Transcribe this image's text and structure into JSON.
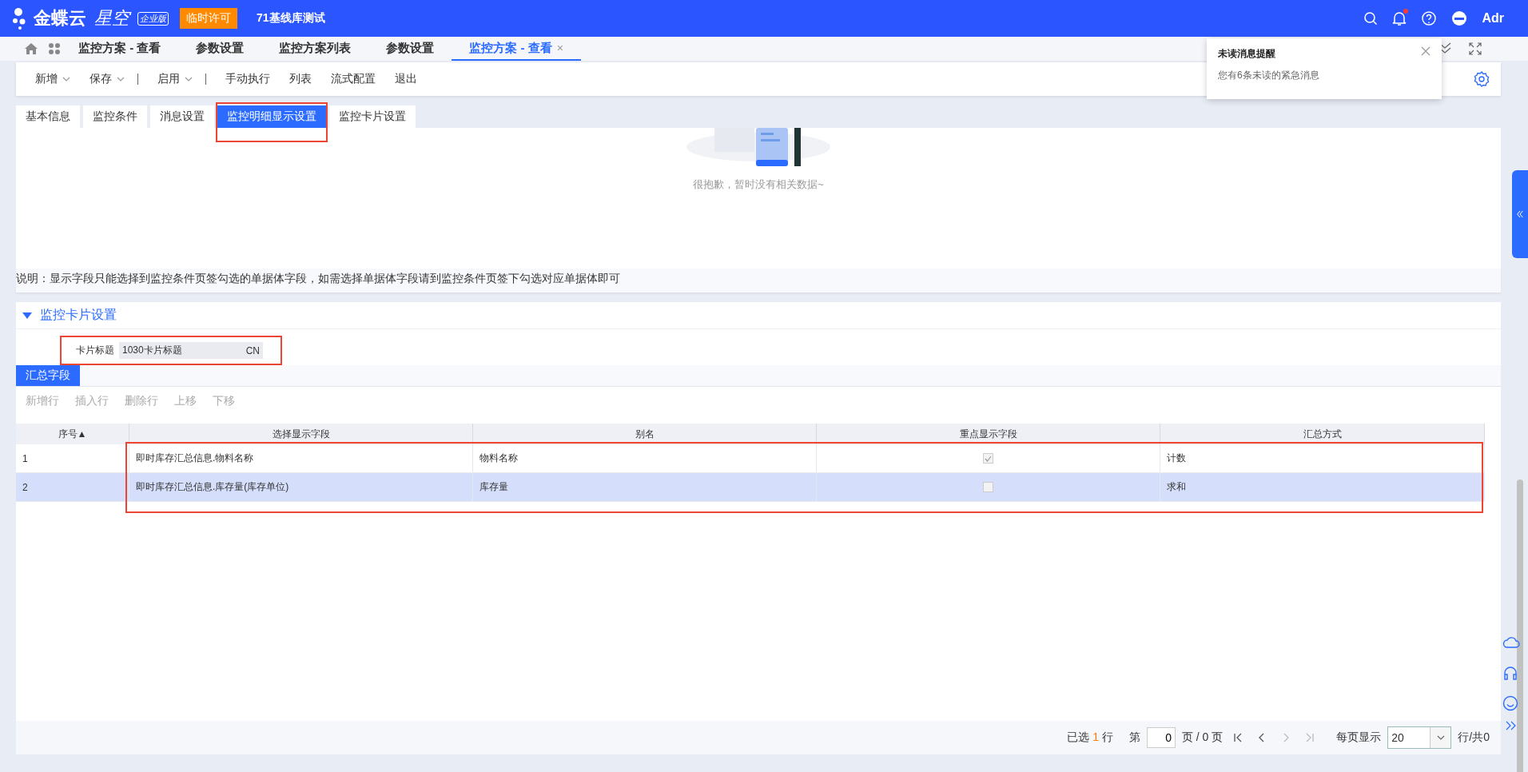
{
  "top_bar": {
    "brand": "金蝶云",
    "product": "星空",
    "edition": "企业版",
    "license_button": "临时许可",
    "tenant": "71基线库测试",
    "user": "Adr",
    "notification_dot": true
  },
  "page_tabs": [
    {
      "label": "监控方案 - 查看",
      "selected": false
    },
    {
      "label": "参数设置",
      "selected": false
    },
    {
      "label": "监控方案列表",
      "selected": false
    },
    {
      "label": "参数设置",
      "selected": false
    },
    {
      "label": "监控方案 - 查看",
      "selected": true,
      "close_mark": "×"
    }
  ],
  "notification": {
    "title": "未读消息提醒",
    "message": "您有6条未读的紧急消息"
  },
  "toolbar": [
    {
      "label": "新增",
      "dropdown": true,
      "separator": false
    },
    {
      "label": "保存",
      "dropdown": true,
      "separator": true
    },
    {
      "label": "启用",
      "dropdown": true,
      "separator": true
    },
    {
      "label": "手动执行",
      "dropdown": false,
      "separator": false
    },
    {
      "label": "列表",
      "dropdown": false,
      "separator": false
    },
    {
      "label": "流式配置",
      "dropdown": false,
      "separator": false
    },
    {
      "label": "退出",
      "dropdown": false,
      "separator": false
    }
  ],
  "form_tabs": [
    {
      "label": "基本信息",
      "selected": false
    },
    {
      "label": "监控条件",
      "selected": false
    },
    {
      "label": "消息设置",
      "selected": false
    },
    {
      "label": "监控明细显示设置",
      "selected": true
    },
    {
      "label": "监控卡片设置",
      "selected": false
    }
  ],
  "empty_state": {
    "message": "很抱歉，暂时没有相关数据~"
  },
  "note": "说明：显示字段只能选择到监控条件页签勾选的单据体字段，如需选择单据体字段请到监控条件页签下勾选对应单据体即可",
  "card_section": {
    "title": "监控卡片设置",
    "expanded": true,
    "card_title": {
      "label": "卡片标题",
      "value": "1030卡片标题",
      "language": "CN"
    },
    "subtabs": [
      {
        "label": "汇总字段",
        "selected": true
      }
    ],
    "row_actions": [
      {
        "label": "新增行",
        "disabled": true
      },
      {
        "label": "插入行",
        "disabled": true
      },
      {
        "label": "删除行",
        "disabled": true
      },
      {
        "label": "上移",
        "disabled": true
      },
      {
        "label": "下移",
        "disabled": true
      }
    ],
    "table": {
      "columns": [
        {
          "label": "序号",
          "sort_mark": "▲"
        },
        {
          "label": "选择显示字段"
        },
        {
          "label": "别名"
        },
        {
          "label": "重点显示字段"
        },
        {
          "label": "汇总方式"
        }
      ],
      "rows": [
        {
          "index": "1",
          "field": "即时库存汇总信息.物料名称",
          "alias": "物料名称",
          "highlight": true,
          "aggregate": "计数",
          "selected": false
        },
        {
          "index": "2",
          "field": "即时库存汇总信息.库存量(库存单位)",
          "alias": "库存量",
          "highlight": false,
          "aggregate": "求和",
          "selected": true
        }
      ]
    },
    "pagination": {
      "selected_prefix": "已选",
      "selected_count": "1",
      "selected_suffix": "行",
      "page_prefix": "第",
      "page": "0",
      "page_total": "页 / 0 页",
      "pager_buttons": [
        {
          "kind": "first",
          "disabled": false
        },
        {
          "kind": "prev",
          "disabled": false
        },
        {
          "kind": "next",
          "disabled": true
        },
        {
          "kind": "last",
          "disabled": true
        }
      ],
      "per_page_label": "每页显示",
      "per_page": "20",
      "total": "行/共0"
    }
  }
}
